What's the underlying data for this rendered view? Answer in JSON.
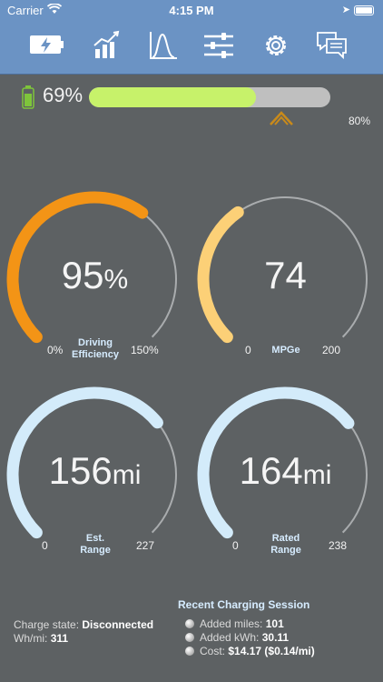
{
  "status_bar": {
    "carrier": "Carrier",
    "time": "4:15 PM"
  },
  "toolbar": {
    "items": [
      {
        "icon": "battery-charging-icon",
        "selected": true
      },
      {
        "icon": "bar-chart-icon",
        "selected": false
      },
      {
        "icon": "distribution-curve-icon",
        "selected": false
      },
      {
        "icon": "sliders-icon",
        "selected": false
      },
      {
        "icon": "gear-icon",
        "selected": false
      },
      {
        "icon": "chat-bubbles-icon",
        "selected": false
      }
    ]
  },
  "battery": {
    "percent_label": "69%",
    "level": 0.69,
    "charge_limit_label": "80%",
    "colors": {
      "fill": "#c7f26a",
      "track": "#bfbfbf",
      "limit_marker": "#c98a1a"
    }
  },
  "gauges": {
    "efficiency": {
      "value": "95",
      "unit": "%",
      "min": "0%",
      "max": "150%",
      "label_line1": "Driving",
      "label_line2": "Efficiency",
      "fraction": 0.633,
      "color": "#f39416"
    },
    "mpge": {
      "value": "74",
      "unit": "",
      "min": "0",
      "max": "200",
      "label_line1": "MPGe",
      "label_line2": "",
      "fraction": 0.37,
      "color": "#fcd077"
    },
    "est_range": {
      "value": "156",
      "unit": "mi",
      "min": "0",
      "max": "227",
      "label_line1": "Est.",
      "label_line2": "Range",
      "fraction": 0.687,
      "color": "#d3ebfa"
    },
    "rated_range": {
      "value": "164",
      "unit": "mi",
      "min": "0",
      "max": "238",
      "label_line1": "Rated",
      "label_line2": "Range",
      "fraction": 0.689,
      "color": "#d3ebfa"
    }
  },
  "footer": {
    "charge_state_label": "Charge state:",
    "charge_state_value": "Disconnected",
    "wh_mi_label": "Wh/mi:",
    "wh_mi_value": "311",
    "session_title": "Recent Charging Session",
    "session_items": [
      {
        "label": "Added miles:",
        "value": "101"
      },
      {
        "label": "Added kWh:",
        "value": "30.11"
      },
      {
        "label": "Cost:",
        "value": "$14.17 ($0.14/mi)"
      }
    ]
  }
}
